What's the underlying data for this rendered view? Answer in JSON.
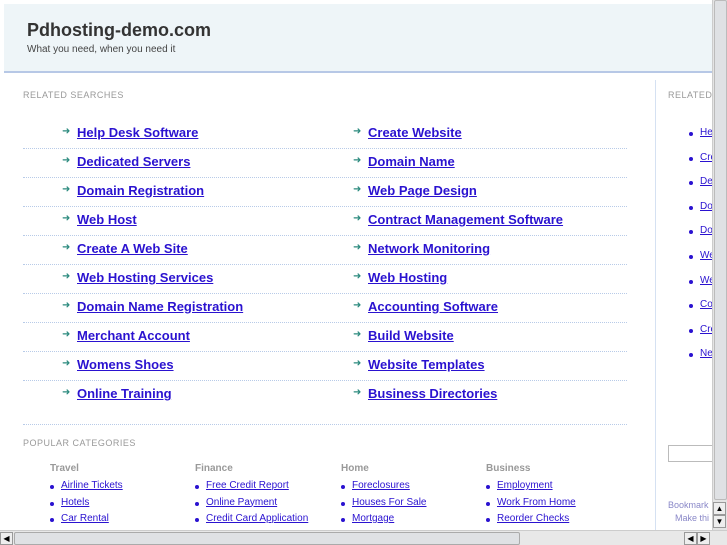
{
  "header": {
    "title": "Pdhosting-demo.com",
    "tagline": "What you need, when you need it"
  },
  "related": {
    "label": "RELATED SEARCHES",
    "left": [
      "Help Desk Software",
      "Dedicated Servers",
      "Domain Registration",
      "Web Host",
      "Create A Web Site",
      "Web Hosting Services",
      "Domain Name Registration",
      "Merchant Account",
      "Womens Shoes",
      "Online Training"
    ],
    "right": [
      "Create Website",
      "Domain Name",
      "Web Page Design",
      "Contract Management Software",
      "Network Monitoring",
      "Web Hosting",
      "Accounting Software",
      "Build Website",
      "Website Templates",
      "Business Directories"
    ]
  },
  "popular": {
    "label": "POPULAR CATEGORIES",
    "columns": [
      {
        "title": "Travel",
        "links": [
          "Airline Tickets",
          "Hotels",
          "Car Rental"
        ]
      },
      {
        "title": "Finance",
        "links": [
          "Free Credit Report",
          "Online Payment",
          "Credit Card Application"
        ]
      },
      {
        "title": "Home",
        "links": [
          "Foreclosures",
          "Houses For Sale",
          "Mortgage"
        ]
      },
      {
        "title": "Business",
        "links": [
          "Employment",
          "Work From Home",
          "Reorder Checks"
        ]
      }
    ]
  },
  "sidebar": {
    "label": "RELATED",
    "links": [
      "He",
      "Cre",
      "De",
      "Do",
      "Do",
      "We",
      "We",
      "Co",
      "Cre",
      "Ne"
    ],
    "bookmark": "Bookmark",
    "make": "Make thi"
  },
  "icons": {
    "arrow": "arrow-right-icon",
    "bullet": "bullet-icon"
  },
  "colors": {
    "link": "#2a12d0",
    "header_bg": "#eef5f8",
    "arrow": "#2b8a7e"
  }
}
